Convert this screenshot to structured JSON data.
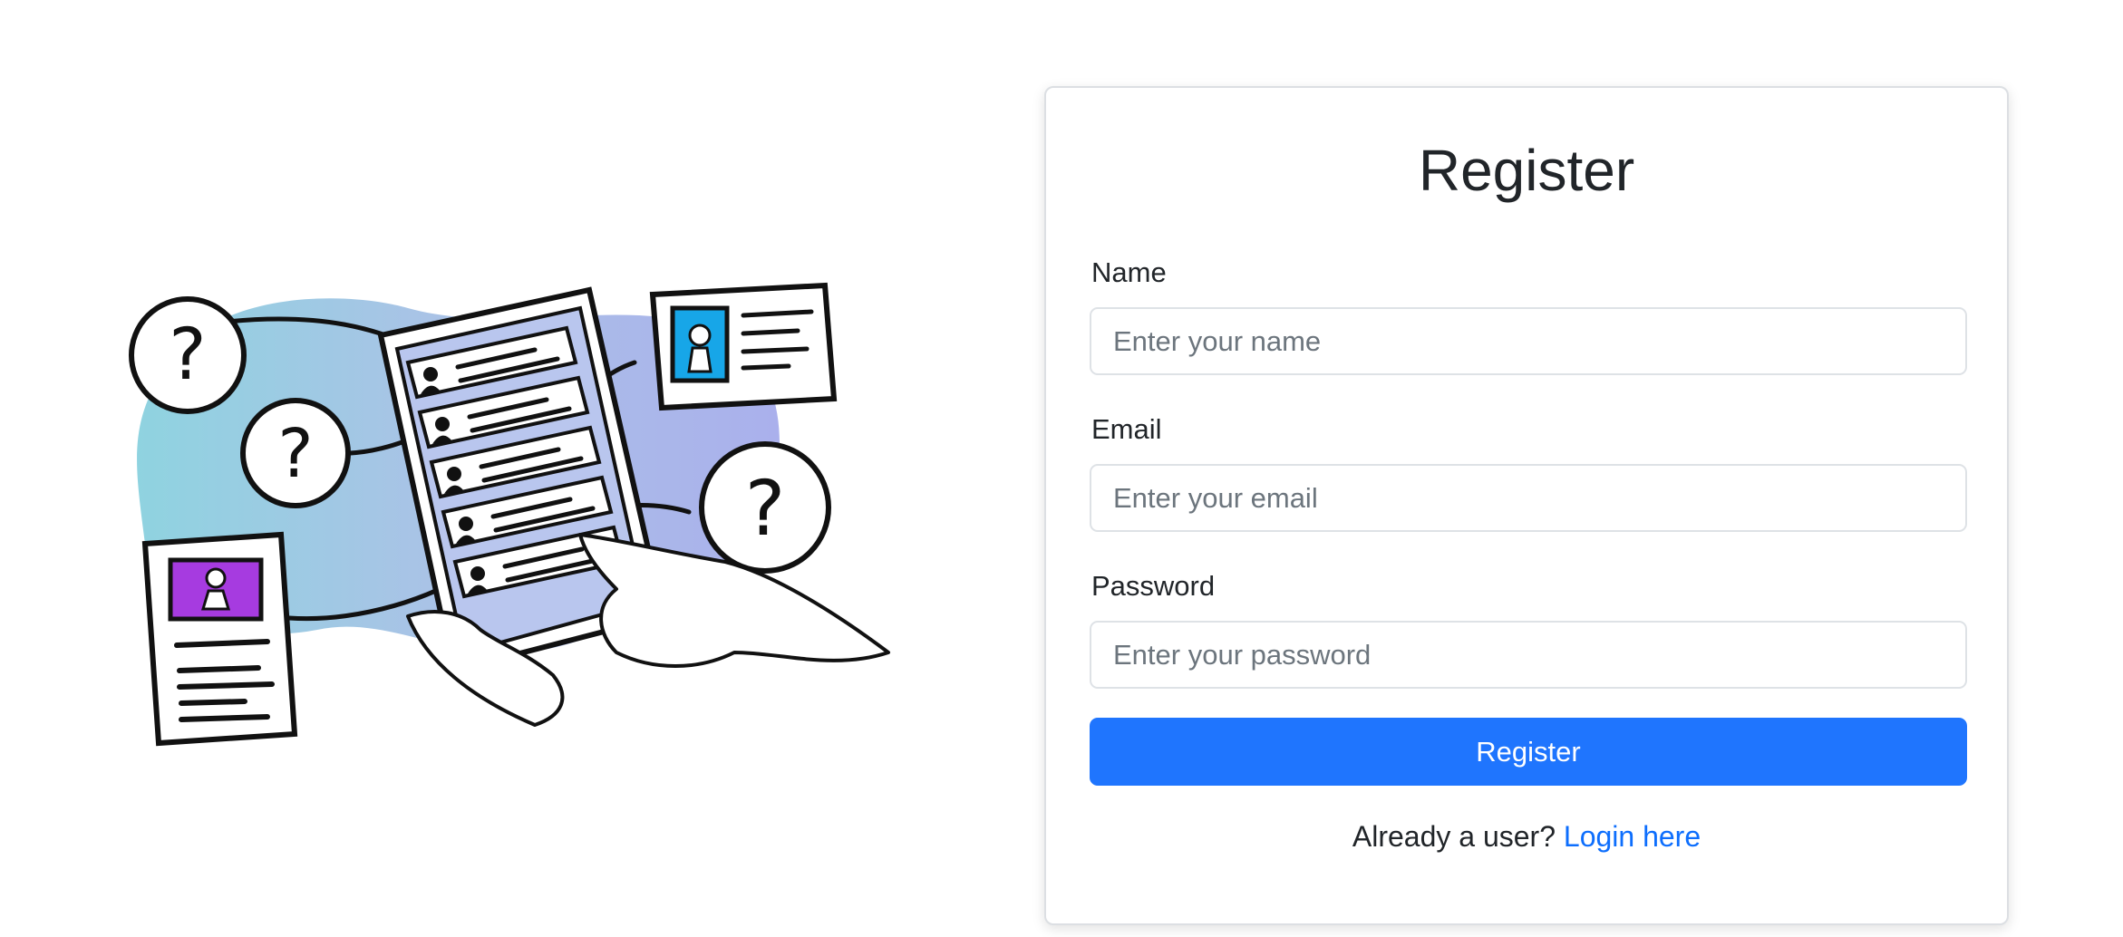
{
  "form": {
    "title": "Register",
    "fields": [
      {
        "label": "Name",
        "placeholder": "Enter your name",
        "value": ""
      },
      {
        "label": "Email",
        "placeholder": "Enter your email",
        "value": ""
      },
      {
        "label": "Password",
        "placeholder": "Enter your password",
        "value": ""
      }
    ],
    "submit_label": "Register",
    "footer_text": "Already a user?",
    "footer_link": "Login here"
  },
  "illustration": {
    "icon": "users-directory-illustration",
    "colors": {
      "blob_left": "#8fd3e0",
      "blob_right": "#a9acec",
      "badge_blue": "#17a6e8",
      "badge_purple": "#a63be0",
      "stroke": "#111111"
    }
  },
  "theme": {
    "primary": "#1f75fe",
    "link": "#0d6efd",
    "text": "#212529",
    "placeholder": "#6c757d",
    "border": "#dee2e6"
  }
}
